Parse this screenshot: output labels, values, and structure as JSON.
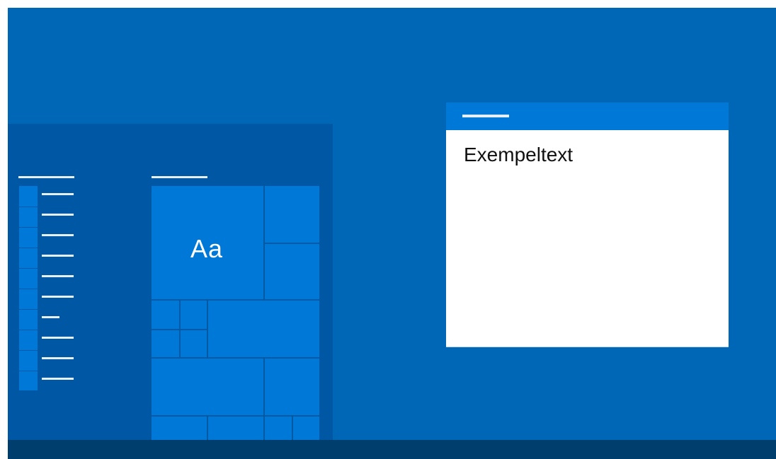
{
  "desktop": {
    "background_color": "#0067b7",
    "taskbar_color": "#003e6e"
  },
  "start_menu": {
    "background_color": "#0057a3",
    "left_list_item_count": 10,
    "tile_accent_color": "#0078d7",
    "tile_label": "Aa"
  },
  "settings_window": {
    "titlebar_color": "#0078d7",
    "content_color": "#ffffff",
    "sample_text": "Exempeltext"
  }
}
